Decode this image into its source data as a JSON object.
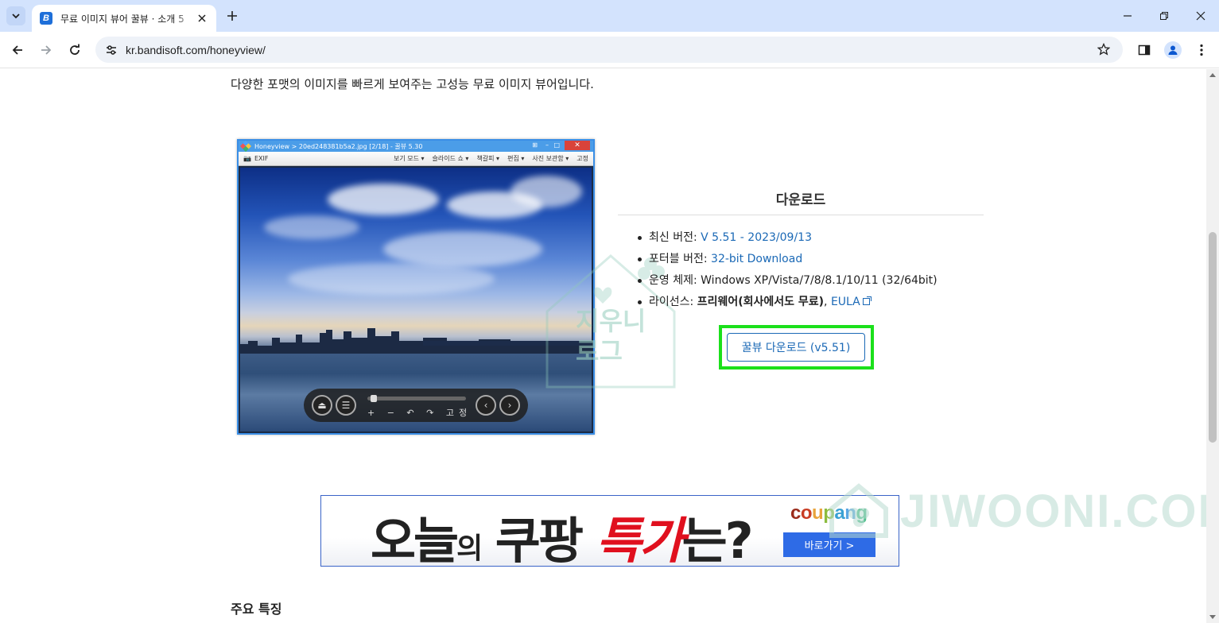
{
  "browser": {
    "tab_title": "무료 이미지 뷰어 꿀뷰 · 소개 5",
    "tab_favicon_letter": "B",
    "url": "kr.bandisoft.com/honeyview/"
  },
  "page": {
    "intro": "다양한 포맷의 이미지를 빠르게 보여주는 고성능 무료 이미지 뷰어입니다.",
    "features_title": "주요 특징"
  },
  "honeyview_screenshot": {
    "title": "Honeyview > 20ed248381b5a2.jpg [2/18] - 꿀뷰 5.30",
    "exif": "EXIF",
    "menu": [
      "보기 모드 ▾",
      "슬라이드 쇼 ▾",
      "책갈피 ▾",
      "편집 ▾",
      "사진 보관함 ▾",
      "고정"
    ],
    "bar_tools": "+ − ↶ ↷ 고정"
  },
  "download": {
    "heading": "다운로드",
    "latest_label": "최신 버전: ",
    "latest_value": "V 5.51 - 2023/09/13",
    "portable_label": "포터블 버전: ",
    "portable_value": "32-bit Download",
    "os_label": "운영 체제: ",
    "os_value": "Windows XP/Vista/7/8/8.1/10/11 (32/64bit)",
    "license_label": "라이선스: ",
    "license_value": "프리웨어(회사에서도 무료)",
    "license_sep": ", ",
    "eula": "EULA",
    "button_label": "꿀뷰 다운로드 (v5.51)"
  },
  "ad": {
    "headline_1": "오늘",
    "headline_2": "의",
    "headline_3": " 쿠팡 ",
    "headline_4": "특가",
    "headline_5": "는?",
    "brand": "coupang",
    "cta": "바로가기 >"
  },
  "watermark": {
    "blog_line1": "지우니",
    "blog_line2": "로그",
    "site": "JIWOONI.COM"
  },
  "colors": {
    "link": "#1b69b6",
    "highlight": "#1be01b",
    "coupang_cta": "#2e6be6",
    "ad_red": "#e0101e"
  }
}
